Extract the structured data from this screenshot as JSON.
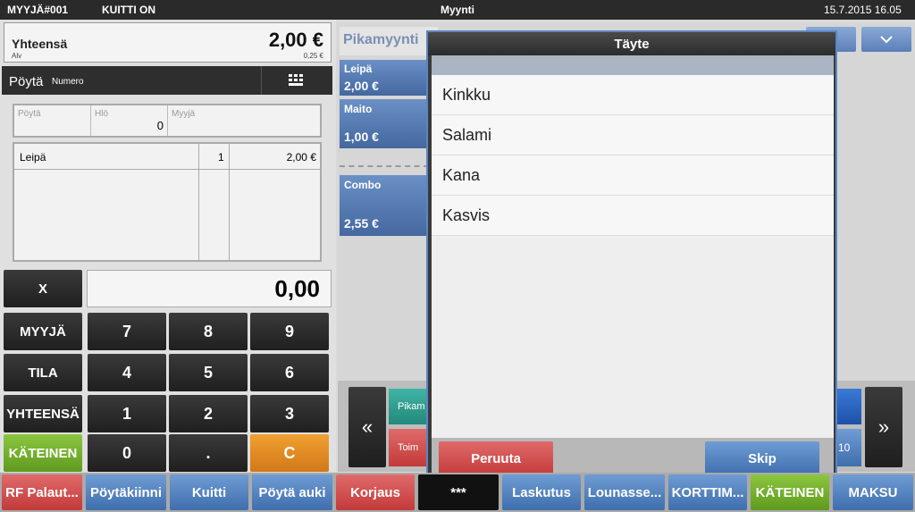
{
  "topbar": {
    "seller": "MYYJÄ#001",
    "receipt": "KUITTI ON",
    "title": "Myynti",
    "datetime": "15.7.2015 16.05"
  },
  "total": {
    "label": "Yhteensä",
    "value": "2,00 €",
    "vat_label": "Alv",
    "vat_value": "0,25 €"
  },
  "table_row": {
    "label": "Pöytä",
    "sub": "Numero"
  },
  "info": {
    "poyta": "Pöytä",
    "hlo": "Hlö",
    "hlo_value": "0",
    "myyja": "Myyjä"
  },
  "receipt_lines": [
    {
      "name": "Leipä",
      "qty": "1",
      "price": "2,00 €"
    }
  ],
  "keypad": {
    "x": "X",
    "display": "0,00",
    "keys": [
      "7",
      "8",
      "9",
      "4",
      "5",
      "6",
      "1",
      "2",
      "3",
      "0",
      ".",
      "C"
    ],
    "side": [
      "MYYJÄ",
      "TILA",
      "YHTEENSÄ",
      "KÄTEINEN"
    ]
  },
  "pikamyynti": {
    "title": "Pikamyynti",
    "tiles": [
      {
        "name": "Leipä",
        "price": "2,00 €"
      },
      {
        "name": "Maito",
        "price": "1,00 €"
      },
      {
        "name": "Combo",
        "price": "2,55 €"
      }
    ]
  },
  "nav": {
    "prev": "«",
    "next": "»",
    "partial_left1": "Pikam",
    "partial_left2": "Toim",
    "partial_right": "10"
  },
  "dialog": {
    "title": "Täyte",
    "items": [
      "Kinkku",
      "Salami",
      "Kana",
      "Kasvis"
    ],
    "cancel": "Peruuta",
    "skip": "Skip"
  },
  "bottom": [
    "RF Palaut...",
    "Pöytäkiinni",
    "Kuitti",
    "Pöytä auki",
    "Korjaus",
    "***",
    "Laskutus",
    "Lounasse...",
    "KORTTIM...",
    "KÄTEINEN",
    "MAKSU"
  ]
}
